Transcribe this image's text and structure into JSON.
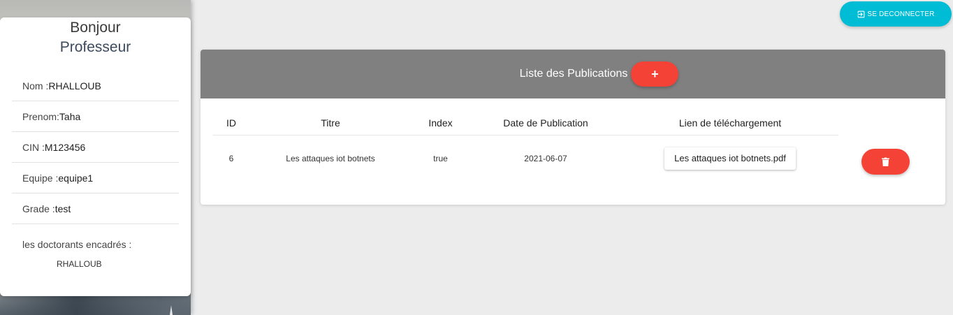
{
  "profile": {
    "greeting": "Bonjour",
    "role": "Professeur",
    "fields": [
      {
        "label": "Nom :",
        "value": "RHALLOUB"
      },
      {
        "label": "Prenom:",
        "value": "Taha"
      },
      {
        "label": "CIN :",
        "value": "M123456"
      },
      {
        "label": "Equipe :",
        "value": "equipe1"
      },
      {
        "label": "Grade :",
        "value": "test"
      }
    ],
    "doctorants_label": "les doctorants encadrés :",
    "doctorants": [
      "RHALLOUB"
    ]
  },
  "header": {
    "logout_label": "SE DECONNECTER",
    "logout_icon": "logout-icon"
  },
  "publications": {
    "title": "Liste des Publications",
    "add_label": "+",
    "columns": [
      "ID",
      "Titre",
      "Index",
      "Date de Publication",
      "Lien de téléchargement"
    ],
    "rows": [
      {
        "id": "6",
        "titre": "Les attaques iot botnets",
        "index": "true",
        "date": "2021-06-07",
        "lien": "Les attaques iot botnets.pdf"
      }
    ],
    "delete_icon": "trash-icon"
  },
  "colors": {
    "accent_cyan": "#00bcd4",
    "accent_red": "#f44336",
    "header_gray": "#808080"
  }
}
